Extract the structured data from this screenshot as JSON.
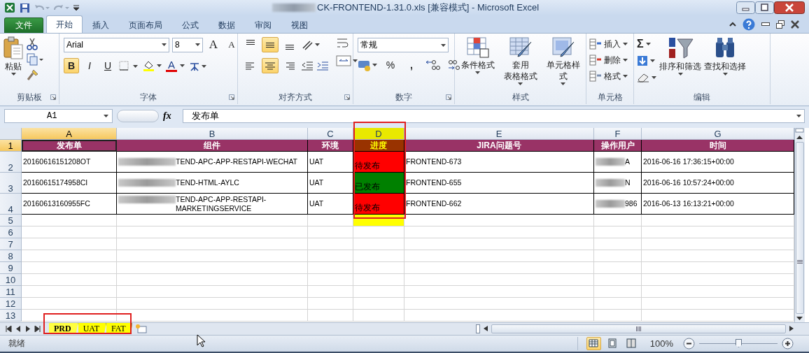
{
  "window": {
    "title": "CK-FRONTEND-1.31.0.xls  [兼容模式]  -  Microsoft Excel"
  },
  "ribbon_tabs": [
    {
      "label": "文件",
      "kind": "file",
      "selected": false
    },
    {
      "label": "开始",
      "kind": "tab",
      "selected": true
    },
    {
      "label": "插入",
      "kind": "tab",
      "selected": false
    },
    {
      "label": "页面布局",
      "kind": "tab",
      "selected": false
    },
    {
      "label": "公式",
      "kind": "tab",
      "selected": false
    },
    {
      "label": "数据",
      "kind": "tab",
      "selected": false
    },
    {
      "label": "审阅",
      "kind": "tab",
      "selected": false
    },
    {
      "label": "视图",
      "kind": "tab",
      "selected": false
    }
  ],
  "clipboard": {
    "paste": "粘贴",
    "label": "剪贴板"
  },
  "font": {
    "name": "Arial",
    "size": "8",
    "grow": "A",
    "shrink": "A",
    "styles": [
      {
        "label": "B",
        "kind": "bold",
        "selected": true
      },
      {
        "label": "I",
        "kind": "italic",
        "selected": false
      },
      {
        "label": "U",
        "kind": "underline",
        "selected": false
      }
    ],
    "font_color": "A",
    "label": "字体"
  },
  "alignment": {
    "vertical": [
      {
        "kind": "top",
        "selected": false
      },
      {
        "kind": "middle",
        "selected": true
      },
      {
        "kind": "bottom",
        "selected": false
      }
    ],
    "horizontal": [
      {
        "kind": "left",
        "selected": false
      },
      {
        "kind": "center",
        "selected": true
      },
      {
        "kind": "right",
        "selected": false
      }
    ],
    "label": "对齐方式"
  },
  "number": {
    "format": "常规",
    "percent": "%",
    "comma": ",",
    "label": "数字"
  },
  "styles": {
    "buttons": [
      {
        "lines": [
          "条件格式"
        ],
        "kind": "conditional"
      },
      {
        "lines": [
          "套用",
          "表格格式"
        ],
        "kind": "table"
      },
      {
        "lines": [
          "单元格样式"
        ],
        "kind": "cell"
      }
    ],
    "label": "样式"
  },
  "cells": {
    "buttons": [
      {
        "label": "插入",
        "kind": "insert"
      },
      {
        "label": "删除",
        "kind": "delete"
      },
      {
        "label": "格式",
        "kind": "format"
      }
    ],
    "label": "单元格"
  },
  "editing": {
    "sum": "Σ",
    "buttons": [
      {
        "label": "排序和筛选",
        "kind": "sort"
      },
      {
        "label": "查找和选择",
        "kind": "find"
      }
    ],
    "label": "编辑"
  },
  "formula_bar": {
    "name_box": "A1",
    "function_label": "fx",
    "formula": "发布单"
  },
  "sheet": {
    "columns": [
      {
        "letter": "A",
        "selected": true,
        "highlighted": false
      },
      {
        "letter": "B",
        "selected": false,
        "highlighted": false
      },
      {
        "letter": "C",
        "selected": false,
        "highlighted": false
      },
      {
        "letter": "D",
        "selected": false,
        "highlighted": true
      },
      {
        "letter": "E",
        "selected": false,
        "highlighted": false
      },
      {
        "letter": "F",
        "selected": false,
        "highlighted": false
      },
      {
        "letter": "G",
        "selected": false,
        "highlighted": false
      }
    ],
    "row_headers": [
      {
        "label": "1",
        "selected": true
      },
      {
        "label": "2",
        "selected": false
      },
      {
        "label": "3",
        "selected": false
      },
      {
        "label": "4",
        "selected": false
      },
      {
        "label": "5",
        "selected": false
      },
      {
        "label": "6",
        "selected": false
      },
      {
        "label": "7",
        "selected": false
      },
      {
        "label": "8",
        "selected": false
      },
      {
        "label": "9",
        "selected": false
      },
      {
        "label": "10",
        "selected": false
      },
      {
        "label": "11",
        "selected": false
      },
      {
        "label": "12",
        "selected": false
      },
      {
        "label": "13",
        "selected": false
      }
    ],
    "header": [
      "发布单",
      "组件",
      "环境",
      "进度",
      "JIRA问题号",
      "操作用户",
      "时间"
    ],
    "rows": [
      {
        "id": "20160616151208OT",
        "component": "TEND-APC-APP-RESTAPI-WECHAT",
        "env": "UAT",
        "status": {
          "text": "待发布",
          "color": "#ff0000"
        },
        "jira": "FRONTEND-673",
        "user": "A",
        "time": "2016-06-16 17:36:15+00:00"
      },
      {
        "id": "20160615174958CI",
        "component": "TEND-HTML-AYLC",
        "env": "UAT",
        "status": {
          "text": "已发布",
          "color": "#008000"
        },
        "jira": "FRONTEND-655",
        "user": "N",
        "time": "2016-06-16 10:57:24+00:00"
      },
      {
        "id": "20160613160955FC",
        "component": "TEND-APC-APP-RESTAPI-MARKETINGSERVICE",
        "env": "UAT",
        "status": {
          "text": "待发布",
          "color": "#ff0000"
        },
        "jira": "FRONTEND-662",
        "user": "986",
        "time": "2016-06-13 16:13:21+00:00"
      }
    ]
  },
  "sheet_tabs": [
    {
      "label": "PRD",
      "selected": true
    },
    {
      "label": "UAT",
      "selected": false
    },
    {
      "label": "FAT",
      "selected": false
    }
  ],
  "status_bar": {
    "text": "就绪",
    "views": [
      {
        "kind": "normal",
        "selected": true
      },
      {
        "kind": "layout",
        "selected": false
      },
      {
        "kind": "pagebreak",
        "selected": false
      }
    ],
    "zoom": "100%",
    "zoom_slider": {
      "level": 0.5
    }
  }
}
